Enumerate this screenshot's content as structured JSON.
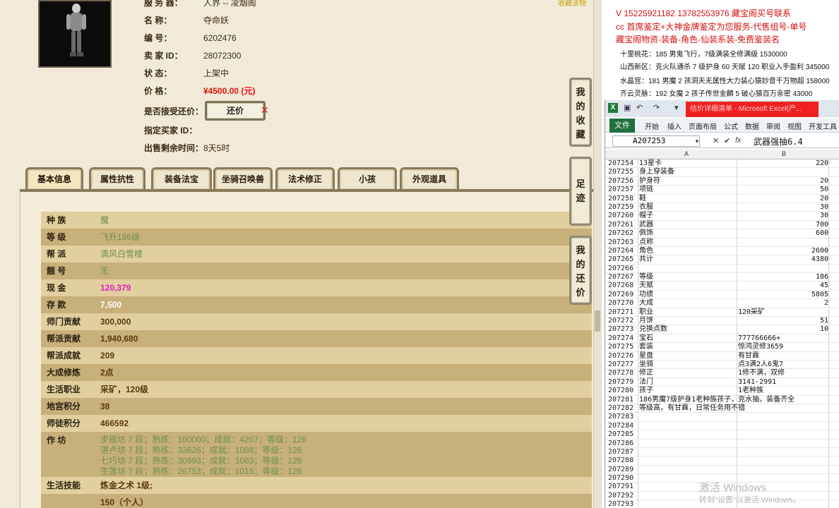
{
  "header": {
    "server_label": "服 务 器：",
    "server_value": "人界 -- 凌烟阁",
    "name_label": "名        称：",
    "name_value": "夺命妖",
    "id_label": "编        号：",
    "id_value": "6202476",
    "seller_label": "卖  家  ID：",
    "seller_value": "28072300",
    "status_label": "状        态：",
    "status_value": "上架中",
    "price_label": "价        格：",
    "price_value": "¥4500.00 (元)",
    "accept_label": "是否接受还价：",
    "counter_btn": "还价",
    "buyer_label": "指定买家 ID：",
    "buyer_value": "",
    "remaining_label": "出售剩余时间：",
    "remaining_value": "8天5时",
    "top_link": "收藏该物"
  },
  "tabs": [
    "基本信息",
    "属性抗性",
    "装备法宝",
    "坐骑召唤兽",
    "法术修正",
    "小孩",
    "外观道具"
  ],
  "side_buttons": [
    {
      "chars": [
        "我",
        "的",
        "收",
        "藏"
      ]
    },
    {
      "chars": [
        "足",
        "迹"
      ]
    },
    {
      "chars": [
        "我",
        "的",
        "还",
        "价"
      ]
    }
  ],
  "basic_info": {
    "race_k": "种    族",
    "race_v": "魔",
    "level_k": "等    级",
    "level_v": "飞升186级",
    "sect_k": "帮    派",
    "sect_v": "清风白雪楼",
    "title_k": "靓    号",
    "title_v": "无",
    "cash_k": "现    金",
    "cash_v": "120,379",
    "deposit_k": "存    款",
    "deposit_v": "7,500",
    "mentor_k": "师门贡献",
    "mentor_v": "300,000",
    "gang_k": "帮派贡献",
    "gang_v": "1,940,680",
    "gangach_k": "帮派成就",
    "gangach_v": "209",
    "cult_k": "大成修炼",
    "cult_v": "2点",
    "life_k": "生活职业",
    "life_v": "采矿，120级",
    "palace_k": "地宫积分",
    "palace_v": "38",
    "disciple_k": "师徒积分",
    "disciple_v": "466592",
    "workshop_k": "作    坊",
    "workshop_lines": [
      "步摇坊 7 段；熟练：100000；成就：4207；等级：126",
      "湛卢坊 7 段；熟练：33626；成就：1088；等级：126",
      "七巧坊 7 段；熟练：30993；成就：1063；等级：126",
      "生莲坊 7 段；熟练：26753；成就：1015；等级：126"
    ],
    "skill_k": "生活技能",
    "skill_v": "炼金之术 1级;",
    "extra_v": "150（个人）"
  },
  "ads": [
    "V 15225921182      13782553976    藏宝阁买号联系",
    "cc 首席鉴定+大神金牌鉴定为您服务-代售组号-单号",
    "藏宝阁物资-装备-角色-仙装系装-免费鉴装名"
  ],
  "ads_black": [
    "十里桃花：185 男鬼飞行，7级满装全修满级 1530000",
    "山西新区：克火队通杀 7 级护身 60 天赋 120 职业入手盈利 345000",
    "水晶宫：181 男魔 2 孩洞天无属性大力装心猿妙音千万物超 158000",
    "齐云灵脉：192 女魔 2 孩子传世金麟 5 破心猿百万亲密 43000"
  ],
  "excel": {
    "title": "估价详细清单 - Microsoft Excel(产...",
    "file_tab": "文件",
    "ribbon_tabs": [
      "开始",
      "插入",
      "页面布局",
      "公式",
      "数据",
      "审阅",
      "视图",
      "开发工具"
    ],
    "name_box": "A207253",
    "formula": "武器强抽6.4",
    "col_a": "A",
    "col_b": "B",
    "rows": [
      {
        "n": "207254",
        "a": "13星卡",
        "b": "220",
        "num": true
      },
      {
        "n": "207255",
        "a": "身上穿装备",
        "b": "",
        "num": true
      },
      {
        "n": "207256",
        "a": "护身符",
        "b": "20",
        "num": true
      },
      {
        "n": "207257",
        "a": "项链",
        "b": "50",
        "num": true
      },
      {
        "n": "207258",
        "a": "鞋",
        "b": "20",
        "num": true
      },
      {
        "n": "207259",
        "a": "衣服",
        "b": "30",
        "num": true
      },
      {
        "n": "207260",
        "a": "帽子",
        "b": "30",
        "num": true
      },
      {
        "n": "207261",
        "a": "武器",
        "b": "700",
        "num": true
      },
      {
        "n": "207262",
        "a": "佩饰",
        "b": "600",
        "num": true
      },
      {
        "n": "207263",
        "a": "点称",
        "b": "",
        "num": true
      },
      {
        "n": "207264",
        "a": "角色",
        "b": "2600",
        "num": true
      },
      {
        "n": "207265",
        "a": "共计",
        "b": "4380",
        "num": true
      },
      {
        "n": "207266",
        "a": "",
        "b": "",
        "num": true
      },
      {
        "n": "207267",
        "a": "等级",
        "b": "186",
        "num": true
      },
      {
        "n": "207268",
        "a": "天赋",
        "b": "45",
        "num": true
      },
      {
        "n": "207269",
        "a": "功绩",
        "b": "5805",
        "num": true
      },
      {
        "n": "207270",
        "a": "大成",
        "b": "2",
        "num": true
      },
      {
        "n": "207271",
        "a": "职业",
        "b": "120采矿",
        "num": false
      },
      {
        "n": "207272",
        "a": "月饼",
        "b": "51",
        "num": true
      },
      {
        "n": "207273",
        "a": "兑换点数",
        "b": "10",
        "num": true
      },
      {
        "n": "207274",
        "a": "宝石",
        "b": "777766666+",
        "num": false
      },
      {
        "n": "207275",
        "a": "套装",
        "b": "惊鸿灵修3659",
        "num": false
      },
      {
        "n": "207276",
        "a": "星盘",
        "b": "有甘霖",
        "num": false
      },
      {
        "n": "207277",
        "a": "坐骑",
        "b": "点3满2人6鬼7",
        "num": false
      },
      {
        "n": "207278",
        "a": "修正",
        "b": "1修不满，双修",
        "num": false
      },
      {
        "n": "207279",
        "a": "法门",
        "b": "3141-2991",
        "num": false
      },
      {
        "n": "207280",
        "a": "孩子",
        "b": "1老种族",
        "num": false
      },
      {
        "n": "207281",
        "a": "186男魔7级护身1老种族孩子，克水抽，装备齐全",
        "b": "",
        "num": false
      },
      {
        "n": "207282",
        "a": "等级高，有甘霖，日常任务用不错",
        "b": "",
        "num": false
      },
      {
        "n": "207283",
        "a": "",
        "b": "",
        "num": false
      },
      {
        "n": "207284",
        "a": "",
        "b": "",
        "num": false
      },
      {
        "n": "207285",
        "a": "",
        "b": "",
        "num": false
      },
      {
        "n": "207286",
        "a": "",
        "b": "",
        "num": false
      },
      {
        "n": "207287",
        "a": "",
        "b": "",
        "num": false
      },
      {
        "n": "207288",
        "a": "",
        "b": "",
        "num": false
      },
      {
        "n": "207289",
        "a": "",
        "b": "",
        "num": false
      },
      {
        "n": "207290",
        "a": "",
        "b": "",
        "num": false
      },
      {
        "n": "207291",
        "a": "",
        "b": "",
        "num": false
      },
      {
        "n": "207292",
        "a": "",
        "b": "",
        "num": false
      },
      {
        "n": "207293",
        "a": "",
        "b": "",
        "num": false
      }
    ]
  },
  "watermark": {
    "line1": "激活 Windows",
    "line2": "转到\"设置\"以激活 Windows。"
  }
}
